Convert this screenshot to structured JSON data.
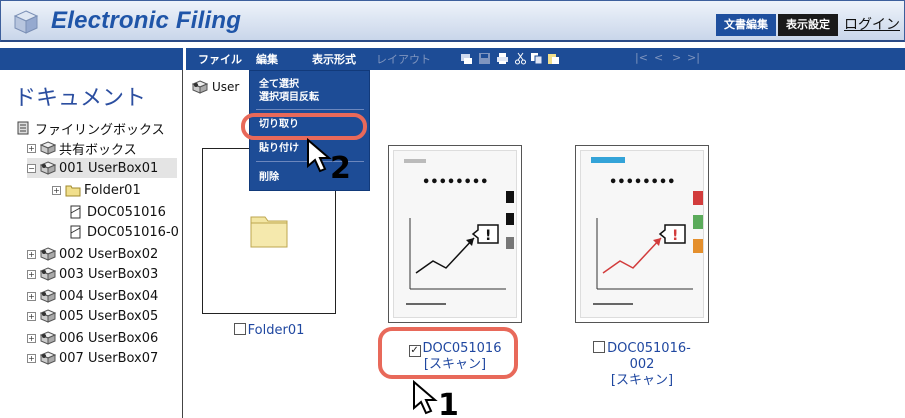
{
  "app": {
    "title": "Electronic Filing",
    "top_buttons": [
      "文書編集",
      "表示設定",
      "ログイン"
    ]
  },
  "menubar": {
    "items": [
      "ファイル",
      "編集",
      "表示形式",
      "レイアウト"
    ],
    "nav_arrows": [
      "|<",
      "<",
      ">",
      ">|"
    ]
  },
  "sidebar": {
    "heading": "ドキュメント",
    "tree": [
      {
        "label": "ファイリングボックス"
      },
      {
        "label": "共有ボックス"
      },
      {
        "label": "001 UserBox01"
      },
      {
        "label": "Folder01"
      },
      {
        "label": "DOC051016"
      },
      {
        "label": "DOC051016-0"
      },
      {
        "label": "002 UserBox02"
      },
      {
        "label": "003 UserBox03"
      },
      {
        "label": "004 UserBox04"
      },
      {
        "label": "005 UserBox05"
      },
      {
        "label": "006 UserBox06"
      },
      {
        "label": "007 UserBox07"
      }
    ]
  },
  "breadcrumb": {
    "text": "User"
  },
  "edit_menu": {
    "items": [
      "全て選択",
      "選択項目反転",
      "切り取り",
      "貼り付け",
      "削除"
    ]
  },
  "content": {
    "items": [
      {
        "name": "Folder01",
        "sub": ""
      },
      {
        "name": "DOC051016",
        "sub": "[スキャン]",
        "checked": true
      },
      {
        "name": "DOC051016-",
        "name2": "002",
        "sub": "[スキャン]",
        "checked": false
      }
    ],
    "doc_dots": "••••••••"
  },
  "steps": {
    "one": "1",
    "two": "2"
  },
  "colors": {
    "accent": "#1d4c96",
    "highlight": "#e8695a"
  }
}
